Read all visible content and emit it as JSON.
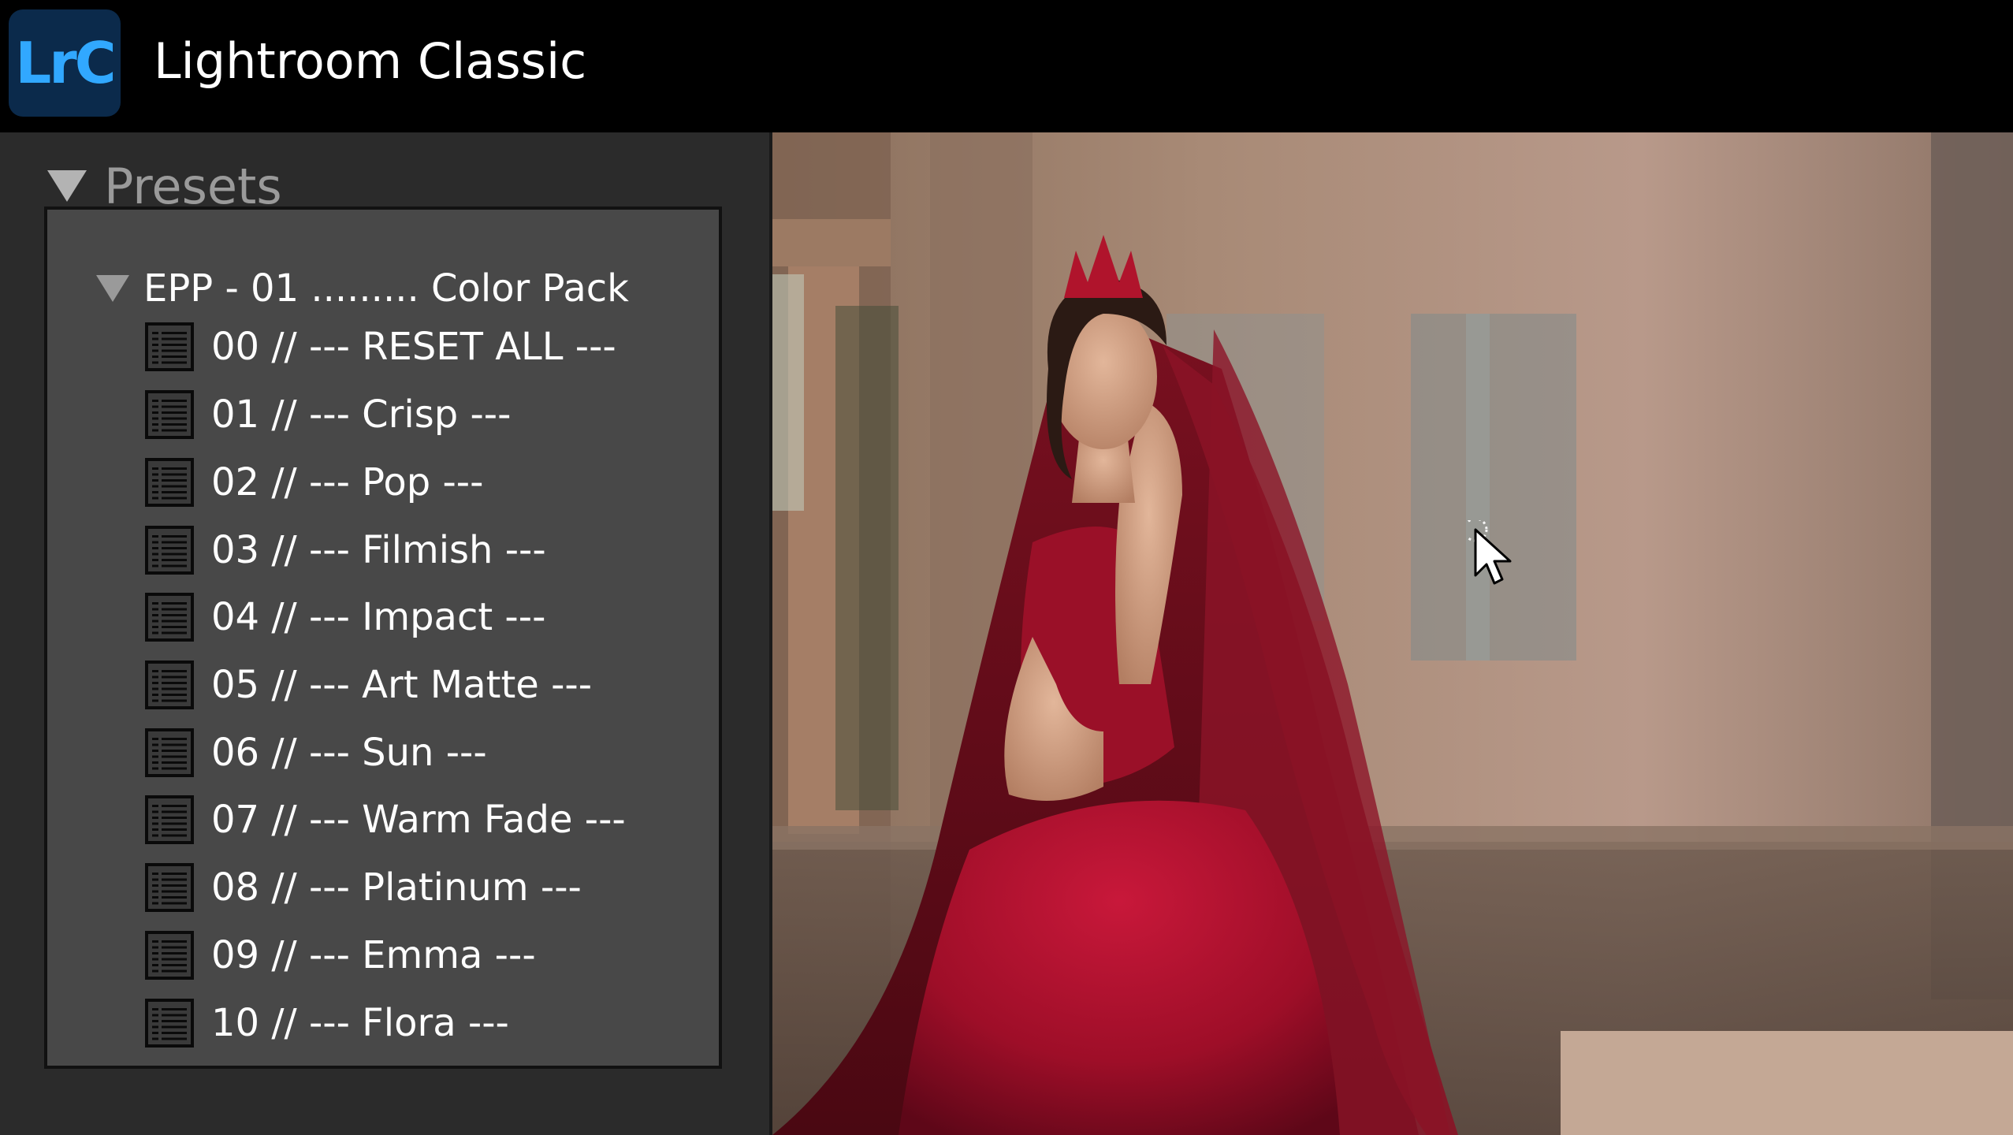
{
  "app": {
    "logo_text": "LrC",
    "title": "Lightroom Classic"
  },
  "panel": {
    "title": "Presets",
    "folder": "EPP - 01 ......... Color Pack",
    "presets": [
      "00  // --- RESET ALL ---",
      "01 // --- Crisp ---",
      "02 // --- Pop ---",
      "03 // --- Filmish ---",
      "04 // --- Impact ---",
      "05 // --- Art Matte ---",
      "06 // --- Sun ---",
      "07 // --- Warm Fade ---",
      "08 // --- Platinum ---",
      "09 // --- Emma ---",
      "10 // --- Flora ---"
    ]
  },
  "photo": {
    "description_icon": "portrait-photo"
  },
  "colors": {
    "logo_bg": "#0b2a4b",
    "logo_text": "#31a8ff",
    "panel_bg": "#2b2b2b",
    "list_bg": "#484848",
    "dress": "#a50f28"
  }
}
